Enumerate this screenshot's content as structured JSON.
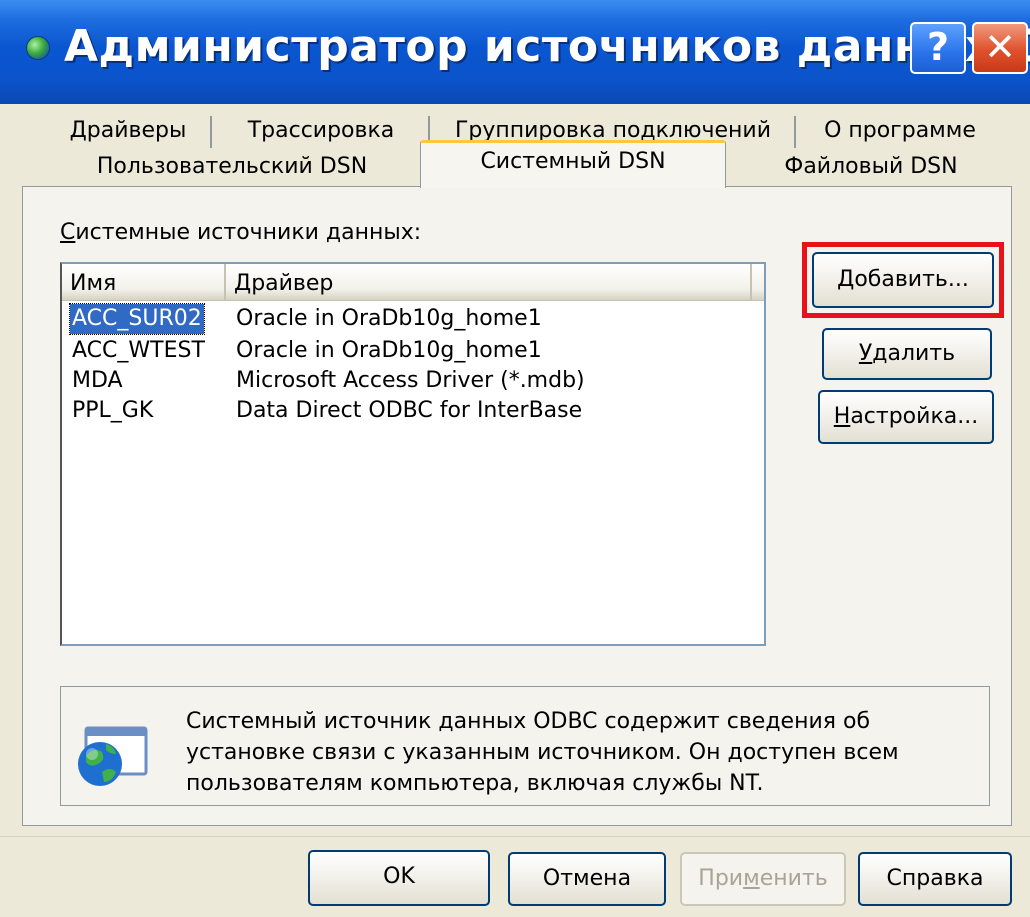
{
  "window": {
    "title": "Администратор источников данных О..."
  },
  "tabs": {
    "row1": [
      "Драйверы",
      "Трассировка",
      "Группировка подключений",
      "О программе"
    ],
    "row2": [
      "Пользовательский DSN",
      "Системный DSN",
      "Файловый DSN"
    ],
    "active": "Системный DSN"
  },
  "panel": {
    "section_label_mnemonic": "С",
    "section_label_rest": "истемные источники данных:",
    "columns": [
      "Имя",
      "Драйвер"
    ],
    "rows": [
      {
        "name": "ACC_SUR02",
        "driver": "Oracle in OraDb10g_home1",
        "selected": true
      },
      {
        "name": "ACC_WTEST",
        "driver": "Oracle in OraDb10g_home1",
        "selected": false
      },
      {
        "name": "MDA",
        "driver": "Microsoft Access Driver (*.mdb)",
        "selected": false
      },
      {
        "name": "PPL_GK",
        "driver": "Data Direct ODBC for InterBase",
        "selected": false
      }
    ],
    "buttons": {
      "add_mnemonic": "Д",
      "add_rest": "обавить...",
      "remove_mnemonic": "У",
      "remove_rest": "далить",
      "configure_mnemonic": "Н",
      "configure_rest": "астройка..."
    },
    "info": {
      "line1": "Системный источник данных ODBC содержит сведения об",
      "line2": "установке связи с указанным источником. Он доступен всем",
      "line3": "пользователям компьютера, включая службы NT."
    }
  },
  "footer": {
    "ok": "OK",
    "cancel": "Отмена",
    "apply_pre": "При",
    "apply_mnemonic": "м",
    "apply_post": "енить",
    "help": "Справка"
  },
  "colors": {
    "title_bar": "#0a56d0",
    "selection": "#316ac5",
    "highlight": "#e8121a",
    "active_tab_accent": "#ffc83c"
  }
}
